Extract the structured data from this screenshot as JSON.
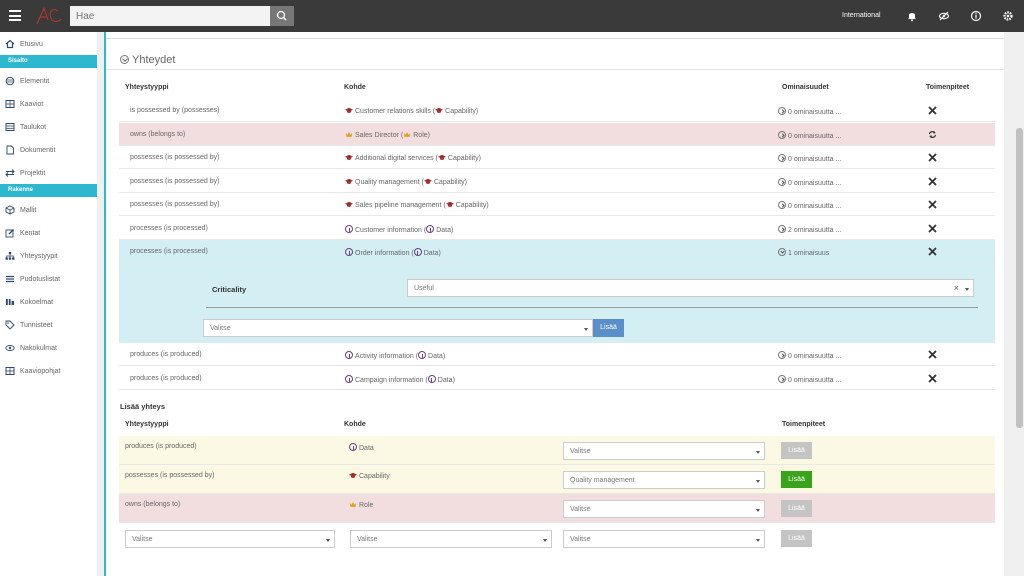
{
  "topbar": {
    "search_placeholder": "Hae",
    "tenant": "International"
  },
  "sidebar": {
    "items_top": [
      {
        "label": "Etusivu",
        "icon": "home-icon"
      }
    ],
    "section1": "Sisalto",
    "items1": [
      {
        "label": "Elementit",
        "icon": "cube-icon"
      },
      {
        "label": "Kaaviot",
        "icon": "diagram-icon"
      },
      {
        "label": "Taulukot",
        "icon": "table-icon"
      },
      {
        "label": "Dokumentit",
        "icon": "document-icon"
      },
      {
        "label": "Projektit",
        "icon": "exchange-icon"
      }
    ],
    "section2": "Rakenne",
    "items2": [
      {
        "label": "Mallit",
        "icon": "model-icon"
      },
      {
        "label": "Kentat",
        "icon": "edit-icon"
      },
      {
        "label": "Yhteystyypit",
        "icon": "sitemap-icon"
      },
      {
        "label": "Pudotuslistat",
        "icon": "list-icon"
      },
      {
        "label": "Kokoelmat",
        "icon": "collection-icon"
      },
      {
        "label": "Tunnisteet",
        "icon": "tag-icon"
      },
      {
        "label": "Nakokulmat",
        "icon": "eye-icon"
      },
      {
        "label": "Kaaviopohjat",
        "icon": "template-icon"
      }
    ]
  },
  "main": {
    "title": "Yhteydet",
    "headers": {
      "type": "Yhteystyyppi",
      "target": "Kohde",
      "properties": "Ominaisuudet",
      "actions": "Toimenpiteet"
    },
    "rows": [
      {
        "type": "is possessed by (possesses)",
        "target": "Customer relations skills",
        "kind": "Capability",
        "icon": "capability",
        "props": "0 ominaisuutta ...",
        "style": "",
        "action": "remove"
      },
      {
        "type": "owns (belongs to)",
        "target": "Sales Director",
        "kind": "Role",
        "icon": "role",
        "props": "0 ominaisuutta ...",
        "style": "pink",
        "action": "refresh"
      },
      {
        "type": "possesses (is possessed by)",
        "target": "Additional digital services",
        "kind": "Capability",
        "icon": "capability",
        "props": "0 ominaisuutta ...",
        "style": "",
        "action": "remove"
      },
      {
        "type": "possesses (is possessed by)",
        "target": "Quality management",
        "kind": "Capability",
        "icon": "capability",
        "props": "0 ominaisuutta ...",
        "style": "",
        "action": "remove"
      },
      {
        "type": "possesses (is possessed by)",
        "target": "Sales pipeline management",
        "kind": "Capability",
        "icon": "capability",
        "props": "0 ominaisuutta ...",
        "style": "",
        "action": "remove"
      },
      {
        "type": "processes (is processed)",
        "target": "Customer information",
        "kind": "Data",
        "icon": "data",
        "props": "2 ominaisuutta ...",
        "style": "",
        "action": "remove"
      },
      {
        "type": "processes (is processed)",
        "target": "Order information",
        "kind": "Data",
        "icon": "data",
        "props": "1 ominaisuus",
        "style": "blue",
        "action": "remove"
      }
    ],
    "expanded": {
      "criticality_label": "Criticality",
      "criticality_value": "Useful",
      "select_placeholder": "Valitse",
      "add_button": "Lisää"
    },
    "rows2": [
      {
        "type": "produces (is produced)",
        "target": "Activity information",
        "kind": "Data",
        "icon": "data",
        "props": "0 ominaisuutta ...",
        "action": "remove"
      },
      {
        "type": "produces (is produced)",
        "target": "Campaign information",
        "kind": "Data",
        "icon": "data",
        "props": "0 ominaisuutta ...",
        "action": "remove"
      }
    ],
    "add_section": {
      "title": "Lisää yhteys",
      "headers": {
        "type": "Yhteystyyppi",
        "target": "Kohde",
        "actions": "Toimenpiteet"
      },
      "rows": [
        {
          "type": "produces (is produced)",
          "target": "Data",
          "icon": "data",
          "select": "Valitse",
          "button": "Lisää",
          "style": "yellow",
          "enabled": false
        },
        {
          "type": "possesses (is possessed by)",
          "target": "Capability",
          "icon": "capability",
          "select": "Quality management",
          "button": "Lisää",
          "style": "yellow",
          "enabled": true
        },
        {
          "type": "owns (belongs to)",
          "target": "Role",
          "icon": "role",
          "select": "Valitse",
          "button": "Lisää",
          "style": "pink",
          "enabled": false
        }
      ],
      "last_row": {
        "select1": "Valitse",
        "select2": "Valitse",
        "select3": "Valitse",
        "button": "Lisää"
      }
    }
  },
  "colors": {
    "accent": "#2eb8cf",
    "topbar": "#3a3a3a",
    "capability": "#a52a2a",
    "role": "#e0a020",
    "data": "#6a3f7d",
    "green": "#38a31b"
  }
}
